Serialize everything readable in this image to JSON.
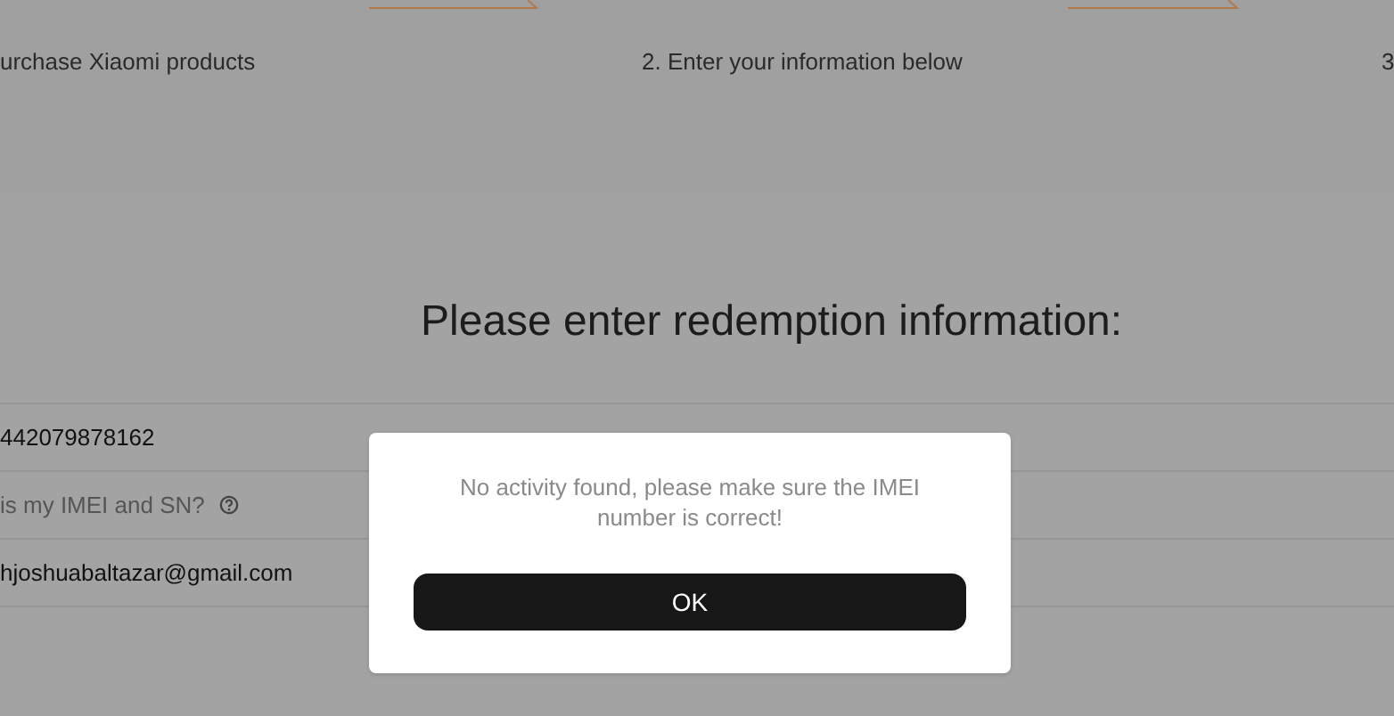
{
  "steps": [
    {
      "label": "urchase Xiaomi products"
    },
    {
      "label": "2. Enter your information below"
    },
    {
      "label": "3"
    }
  ],
  "title": "Please enter redemption information:",
  "form_rows": [
    {
      "kind": "value",
      "text": "442079878162"
    },
    {
      "kind": "help",
      "text": "is my IMEI and SN?"
    },
    {
      "kind": "value",
      "text": "hjoshuabaltazar@gmail.com"
    }
  ],
  "dialog": {
    "message": "No activity found, please make sure the IMEI number is correct!",
    "button": "OK"
  }
}
